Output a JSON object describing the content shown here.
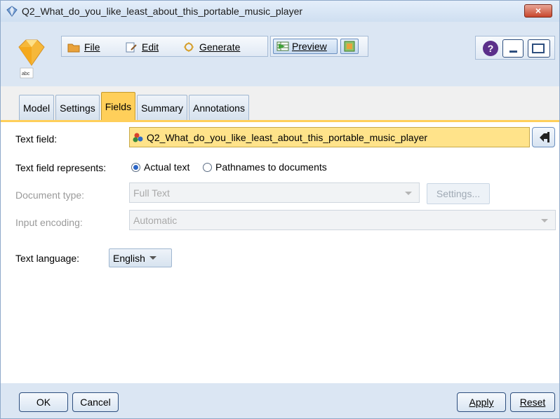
{
  "window": {
    "title": "Q2_What_do_you_like_least_about_this_portable_music_player",
    "close_label": "×"
  },
  "node": {
    "icon_caption": "abc"
  },
  "menu": {
    "file": "File",
    "edit": "Edit",
    "generate": "Generate"
  },
  "toolbar": {
    "preview": "Preview"
  },
  "controls": {
    "help": "?"
  },
  "tabs": [
    "Model",
    "Settings",
    "Fields",
    "Summary",
    "Annotations"
  ],
  "active_tab": "Fields",
  "fields": {
    "text_field_label": "Text field:",
    "text_field_value": "Q2_What_do_you_like_least_about_this_portable_music_player",
    "represents_label": "Text field represents:",
    "represents_options": [
      "Actual text",
      "Pathnames to documents"
    ],
    "represents_selected": "Actual text",
    "doc_type_label": "Document type:",
    "doc_type_value": "Full Text",
    "doc_settings_button": "Settings...",
    "encoding_label": "Input encoding:",
    "encoding_value": "Automatic",
    "language_label": "Text language:",
    "language_value": "English"
  },
  "footer": {
    "ok": "OK",
    "cancel": "Cancel",
    "apply": "Apply",
    "reset": "Reset"
  },
  "colors": {
    "active_tab": "#ffcf5a",
    "text_field_bg": "#ffe38a",
    "chrome": "#dbe6f3"
  }
}
